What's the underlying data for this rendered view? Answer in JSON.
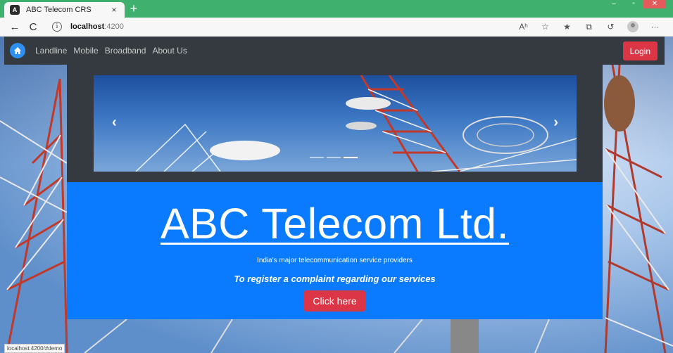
{
  "browser": {
    "tab_title": "ABC Telecom CRS",
    "tab_close": "×",
    "new_tab": "+",
    "url_host": "localhost",
    "url_port": ":4200",
    "back": "←",
    "refresh": "C",
    "info": "i",
    "read_aloud": "Aʰ",
    "more": "···"
  },
  "navbar": {
    "links": [
      "Landline",
      "Mobile",
      "Broadband",
      "About Us"
    ],
    "login_label": "Login"
  },
  "carousel": {
    "prev": "‹",
    "next": "›",
    "slide_count": 3,
    "active_index": 2
  },
  "jumbotron": {
    "title": "ABC Telecom Ltd.",
    "subtitle": "India's major telecommunication service providers",
    "cta_text": "To register a complaint regarding our services",
    "button_label": "Click here"
  },
  "status_bar": {
    "link_preview": "localhost:4200/#demo"
  },
  "colors": {
    "navbar": "#343a40",
    "jumbotron": "#0a7bff",
    "danger": "#dc3545",
    "tabstrip": "#3fb06d"
  }
}
